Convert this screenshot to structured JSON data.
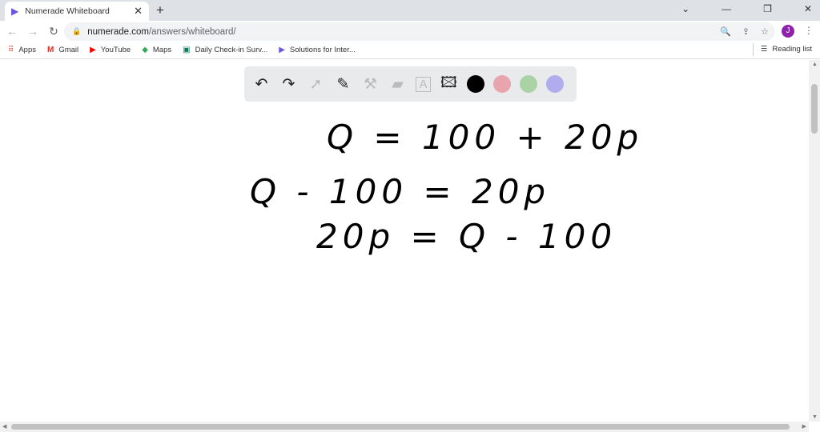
{
  "browser": {
    "tab_title": "Numerade Whiteboard",
    "url_host": "numerade.com",
    "url_path": "/answers/whiteboard/",
    "avatar_letter": "J",
    "bookmarks": [
      {
        "label": "Apps",
        "icon": "apps-grid-icon"
      },
      {
        "label": "Gmail",
        "icon": "gmail-icon"
      },
      {
        "label": "YouTube",
        "icon": "youtube-icon"
      },
      {
        "label": "Maps",
        "icon": "maps-icon"
      },
      {
        "label": "Daily Check-in Surv...",
        "icon": "forms-icon"
      },
      {
        "label": "Solutions for Inter...",
        "icon": "numerade-icon"
      }
    ],
    "reading_list": "Reading list"
  },
  "whiteboard": {
    "tools": [
      "undo",
      "redo",
      "select",
      "pen",
      "tools",
      "eraser",
      "text",
      "image"
    ],
    "colors": [
      "#000000",
      "#e8a5ad",
      "#a9d3a5",
      "#b0acee"
    ],
    "lines": [
      "Q = 100 + 20p",
      "Q - 100 = 20p",
      "20p = Q - 100"
    ]
  }
}
